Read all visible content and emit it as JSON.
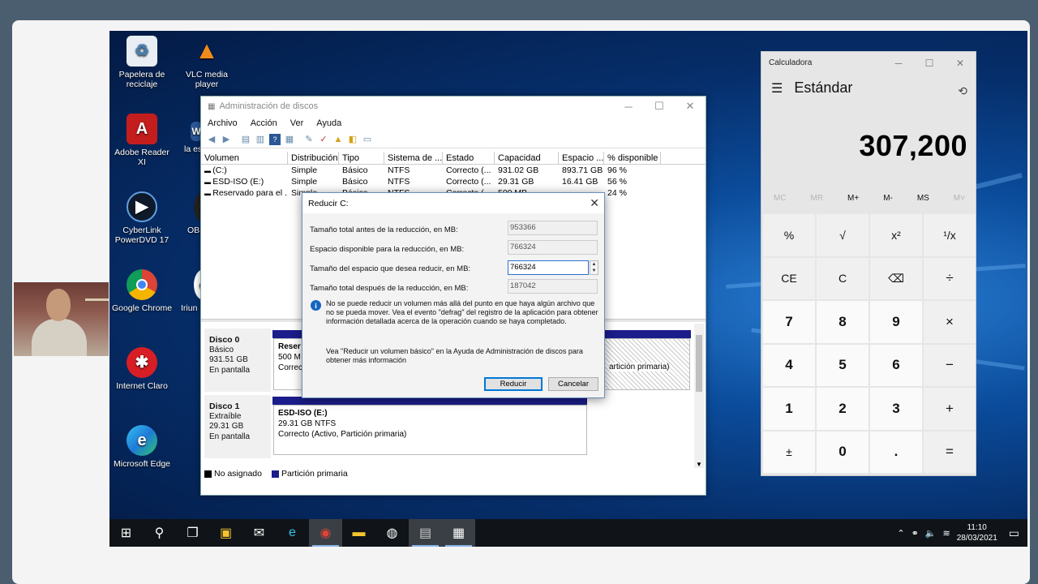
{
  "desktop_icons": [
    {
      "label": "Papelera de reciclaje",
      "icon": "recycle-bin-icon"
    },
    {
      "label": "VLC media player",
      "icon": "vlc-icon"
    },
    {
      "label": "Adobe Reader XI",
      "icon": "adobe-reader-icon"
    },
    {
      "label": "la es...",
      "icon": "word-icon"
    },
    {
      "label": "CyberLink PowerDVD 17",
      "icon": "powerdvd-icon"
    },
    {
      "label": "OBS",
      "icon": "obs-icon"
    },
    {
      "label": "Google Chrome",
      "icon": "chrome-icon"
    },
    {
      "label": "Iriun",
      "icon": "iriun-icon"
    },
    {
      "label": "Internet Claro",
      "icon": "internet-claro-icon"
    },
    {
      "label": "Microsoft Edge",
      "icon": "edge-icon"
    }
  ],
  "disk_mgmt": {
    "title": "Administración de discos",
    "menu": [
      "Archivo",
      "Acción",
      "Ver",
      "Ayuda"
    ],
    "columns": [
      "Volumen",
      "Distribución",
      "Tipo",
      "Sistema de ...",
      "Estado",
      "Capacidad",
      "Espacio ...",
      "% disponible"
    ],
    "volumes": [
      {
        "name": "(C:)",
        "layout": "Simple",
        "type": "Básico",
        "fs": "NTFS",
        "status": "Correcto (...",
        "capacity": "931.02 GB",
        "free": "893.71 GB",
        "pct": "96 %"
      },
      {
        "name": "ESD-ISO (E:)",
        "layout": "Simple",
        "type": "Básico",
        "fs": "NTFS",
        "status": "Correcto (...",
        "capacity": "29.31 GB",
        "free": "16.41 GB",
        "pct": "56 %"
      },
      {
        "name": "Reservado para el ...",
        "layout": "Simple",
        "type": "Básico",
        "fs": "NTFS",
        "status": "Correcto (...",
        "capacity": "500 MB",
        "free": "",
        "pct": "24 %"
      }
    ],
    "disk0": {
      "name": "Disco 0",
      "kind": "Básico",
      "size": "931.51 GB",
      "state": "En pantalla",
      "part_title": "Reser",
      "part_size": "500 M",
      "part_state": "Correc",
      "part2_state": "artición primaria)"
    },
    "disk1": {
      "name": "Disco 1",
      "kind": "Extraíble",
      "size": "29.31 GB",
      "state": "En pantalla",
      "part_title": "ESD-ISO  (E:)",
      "part_size": "29.31 GB NTFS",
      "part_state": "Correcto (Activo, Partición primaria)"
    },
    "legend": {
      "unallocated": "No asignado",
      "primary": "Partición primaria"
    }
  },
  "dialog": {
    "title": "Reducir C:",
    "row1_label": "Tamaño total antes de la reducción, en MB:",
    "row1_value": "953366",
    "row2_label": "Espacio disponible para la reducción, en MB:",
    "row2_value": "766324",
    "row3_label": "Tamaño del espacio que desea reducir, en MB:",
    "row3_value": "766324",
    "row4_label": "Tamaño total después de la reducción, en MB:",
    "row4_value": "187042",
    "info": "No se puede reducir un volumen más allá del punto en que haya algún archivo que no se pueda mover. Vea el evento \"defrag\" del registro de la aplicación para obtener información detallada acerca de la operación cuando se haya completado.",
    "help": "Vea \"Reducir un volumen básico\"  en la Ayuda de Administración de discos para obtener más información",
    "ok": "Reducir",
    "cancel": "Cancelar"
  },
  "calculator": {
    "title": "Calculadora",
    "mode": "Estándar",
    "display": "307,200",
    "memory": [
      "MC",
      "MR",
      "M+",
      "M-",
      "MS",
      "M˅"
    ],
    "keys": [
      "%",
      "√",
      "x²",
      "¹/x",
      "CE",
      "C",
      "⌫",
      "÷",
      "7",
      "8",
      "9",
      "×",
      "4",
      "5",
      "6",
      "−",
      "1",
      "2",
      "3",
      "+",
      "±",
      "0",
      ".",
      "="
    ]
  },
  "taskbar": {
    "time": "11:10",
    "date": "28/03/2021"
  }
}
